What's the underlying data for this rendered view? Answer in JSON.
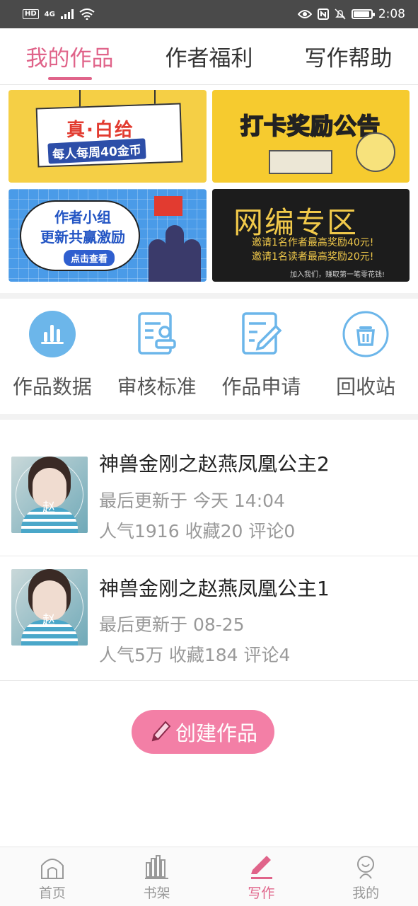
{
  "status_bar": {
    "time": "2:08",
    "network": "4G",
    "hd": "HD",
    "battery_level": 0.85
  },
  "tabs": [
    {
      "label": "我的作品",
      "active": true
    },
    {
      "label": "作者福利",
      "active": false
    },
    {
      "label": "写作帮助",
      "active": false
    }
  ],
  "banners": {
    "b1": {
      "title": "真·白给",
      "subtitle": "每人每周40金币"
    },
    "b2": {
      "title": "打卡奖励公告"
    },
    "b3": {
      "title": "作者小组\n更新共赢激励",
      "button": "点击查看"
    },
    "b4": {
      "title": "网编专区",
      "line1": "邀请1名作者最高奖励40元!",
      "line2": "邀请1名读者最高奖励20元!",
      "footer": "加入我们，赚取第一笔零花钱!"
    }
  },
  "quick_actions": [
    {
      "label": "作品数据",
      "icon": "bar-chart-icon"
    },
    {
      "label": "审核标准",
      "icon": "review-standard-icon"
    },
    {
      "label": "作品申请",
      "icon": "edit-document-icon"
    },
    {
      "label": "回收站",
      "icon": "trash-icon"
    }
  ],
  "works": [
    {
      "title": "神兽金刚之赵燕凤凰公主2",
      "updated": "最后更新于 今天 14:04",
      "stats": "人气1916 收藏20 评论0",
      "cover_char": "赵"
    },
    {
      "title": "神兽金刚之赵燕凤凰公主1",
      "updated": "最后更新于 08-25",
      "stats": "人气5万 收藏184 评论4",
      "cover_char": "赵"
    }
  ],
  "create_button": "创建作品",
  "bottom_nav": [
    {
      "label": "首页",
      "icon": "home-icon",
      "active": false
    },
    {
      "label": "书架",
      "icon": "bookshelf-icon",
      "active": false
    },
    {
      "label": "写作",
      "icon": "pen-icon",
      "active": true
    },
    {
      "label": "我的",
      "icon": "profile-icon",
      "active": false
    }
  ],
  "colors": {
    "accent": "#e0648a",
    "create_button": "#f37fa6",
    "icon_blue": "#6cb6ea"
  }
}
